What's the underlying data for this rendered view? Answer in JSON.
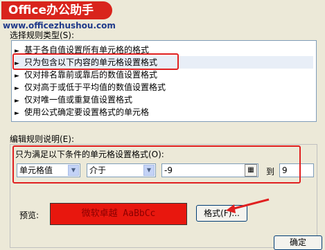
{
  "watermark": {
    "logo": "Office办公助手",
    "url": "www.officezhushou.com"
  },
  "rule_type": {
    "label": "选择规则类型(S):",
    "items": [
      {
        "label": "基于各自值设置所有单元格的格式"
      },
      {
        "label": "只为包含以下内容的单元格设置格式",
        "selected": true
      },
      {
        "label": "仅对排名靠前或靠后的数值设置格式"
      },
      {
        "label": "仅对高于或低于平均值的数值设置格式"
      },
      {
        "label": "仅对唯一值或重复值设置格式"
      },
      {
        "label": "使用公式确定要设置格式的单元格"
      }
    ]
  },
  "rule_desc": {
    "label": "编辑规则说明(E):",
    "condition_label": "只为满足以下条件的单元格设置格式(O):",
    "field_select": "单元格值",
    "operator_select": "介于",
    "value_from": "-9",
    "to_label": "到",
    "value_to": "9",
    "preview_label": "预览:",
    "preview_text": "微软卓越  AaBbCc",
    "format_button": "格式(F)..."
  },
  "footer": {
    "ok_button": "确定"
  },
  "colors": {
    "highlight": "#e02020",
    "preview_fill": "#e8170e"
  }
}
